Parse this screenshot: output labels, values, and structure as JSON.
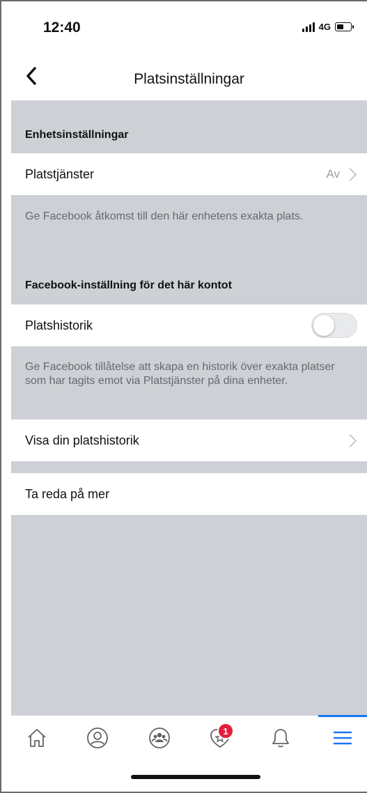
{
  "status": {
    "time": "12:40",
    "network": "4G"
  },
  "nav": {
    "title": "Platsinställningar"
  },
  "sections": {
    "device_header": "Enhetsinställningar",
    "location_services_label": "Platstjänster",
    "location_services_value": "Av",
    "location_services_desc": "Ge Facebook åtkomst till den här enhetens exakta plats.",
    "account_header": "Facebook-inställning för det här kontot",
    "location_history_label": "Platshistorik",
    "location_history_enabled": false,
    "location_history_desc": "Ge Facebook tillåtelse att skapa en historik över exakta platser som har tagits emot via Platstjänster på dina enheter.",
    "view_history_label": "Visa din platshistorik",
    "learn_more_label": "Ta reda på mer"
  },
  "tabbar": {
    "items": [
      "home-icon",
      "profile-icon",
      "groups-icon",
      "marketplace-icon",
      "notifications-icon",
      "menu-icon"
    ],
    "badge_count": "1",
    "active": "menu-icon",
    "accent": "#1877f2",
    "badge_color": "#e41e3f"
  },
  "colors": {
    "background_gray": "#cdd0d4",
    "text": "#111111",
    "secondary_text": "#666a70"
  }
}
